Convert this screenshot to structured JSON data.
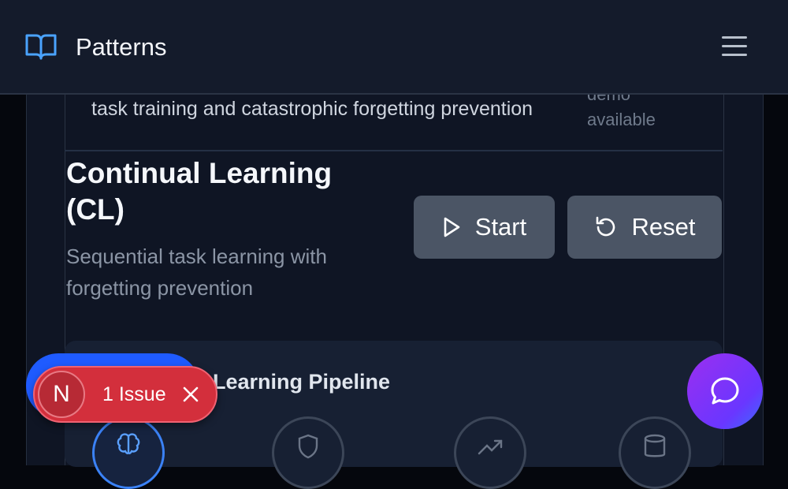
{
  "header": {
    "title": "Patterns",
    "logo_icon": "book-open-icon",
    "menu_icon": "hamburger-menu-icon"
  },
  "previous_card": {
    "description_tail": "task training and catastrophic forgetting prevention",
    "status": "demo available"
  },
  "pattern": {
    "title": "Continual Learning (CL)",
    "subtitle": "Sequential task learning with forgetting prevention",
    "start_label": "Start",
    "reset_label": "Reset"
  },
  "pipeline": {
    "title": "Continual Learning Pipeline",
    "visible_title": "al Learning Pipeline",
    "nodes": [
      "brain-icon",
      "shield-icon",
      "trending-up-icon",
      "database-icon"
    ]
  },
  "issue_badge": {
    "avatar_letter": "N",
    "label": "1 Issue"
  },
  "colors": {
    "accent_blue": "#3b82f6",
    "issue_red": "#d32f3c",
    "chat_gradient_start": "#9b2ff0",
    "chat_gradient_end": "#3b6bff"
  }
}
